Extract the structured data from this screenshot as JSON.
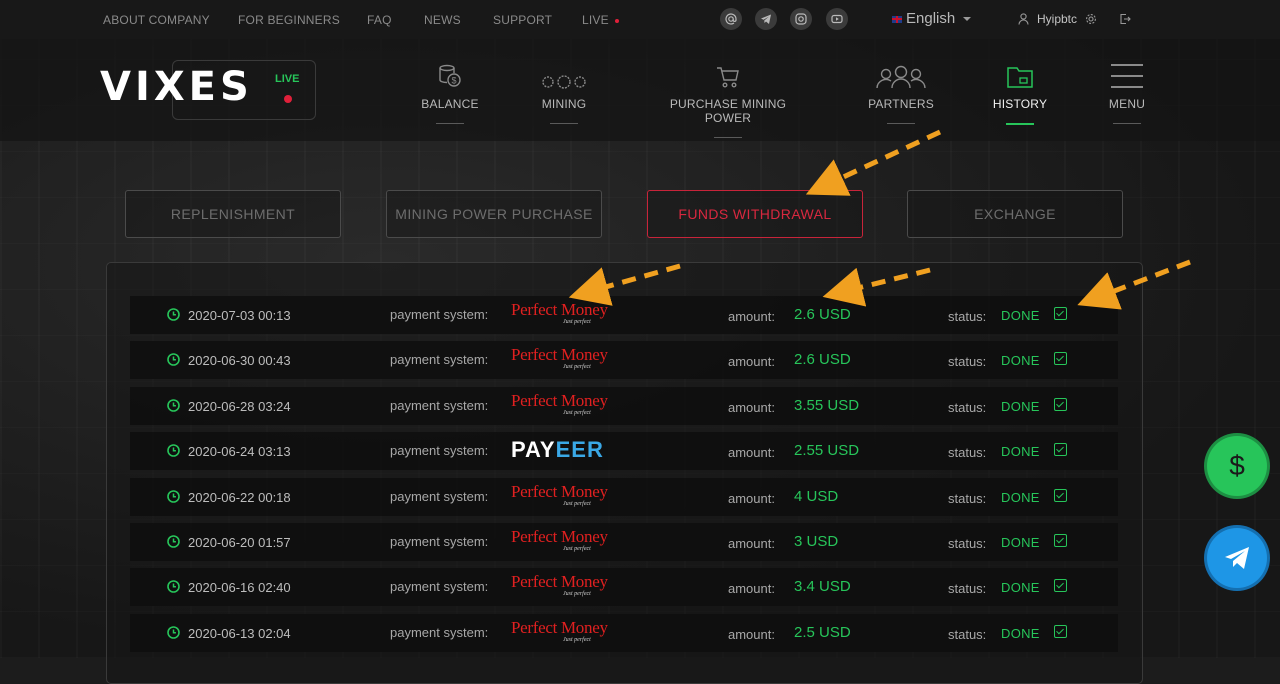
{
  "topbar": {
    "links": [
      "ABOUT COMPANY",
      "FOR BEGINNERS",
      "FAQ",
      "NEWS",
      "SUPPORT",
      "LIVE"
    ],
    "social_icons": [
      "at-icon",
      "telegram-icon",
      "instagram-icon",
      "youtube-icon"
    ],
    "language": "English",
    "username": "Hyipbtc"
  },
  "header": {
    "logo": "VIXES",
    "live_label": "LIVE",
    "nav": [
      {
        "label": "BALANCE",
        "icon": "coins-icon"
      },
      {
        "label": "MINING",
        "icon": "mining-icon"
      },
      {
        "label": "PURCHASE MINING POWER",
        "icon": "cart-icon"
      },
      {
        "label": "PARTNERS",
        "icon": "partners-icon"
      },
      {
        "label": "HISTORY",
        "icon": "history-folder-icon",
        "active": true
      },
      {
        "label": "MENU",
        "icon": "hamburger-icon"
      }
    ]
  },
  "tabs": [
    {
      "label": "REPLENISHMENT"
    },
    {
      "label": "MINING POWER PURCHASE"
    },
    {
      "label": "FUNDS WITHDRAWAL",
      "active": true
    },
    {
      "label": "EXCHANGE"
    }
  ],
  "history": {
    "payment_label": "payment system:",
    "amount_label": "amount:",
    "status_label": "status:",
    "pm_sub": "Just perfect",
    "rows": [
      {
        "date": "2020-07-03 00:13",
        "system": "Perfect Money",
        "amount": "2.6 USD",
        "status": "DONE"
      },
      {
        "date": "2020-06-30 00:43",
        "system": "Perfect Money",
        "amount": "2.6 USD",
        "status": "DONE"
      },
      {
        "date": "2020-06-28 03:24",
        "system": "Perfect Money",
        "amount": "3.55 USD",
        "status": "DONE"
      },
      {
        "date": "2020-06-24 03:13",
        "system": "PAYEER",
        "amount": "2.55 USD",
        "status": "DONE"
      },
      {
        "date": "2020-06-22 00:18",
        "system": "Perfect Money",
        "amount": "4 USD",
        "status": "DONE"
      },
      {
        "date": "2020-06-20 01:57",
        "system": "Perfect Money",
        "amount": "3 USD",
        "status": "DONE"
      },
      {
        "date": "2020-06-16 02:40",
        "system": "Perfect Money",
        "amount": "3.4 USD",
        "status": "DONE"
      },
      {
        "date": "2020-06-13 02:04",
        "system": "Perfect Money",
        "amount": "2.5 USD",
        "status": "DONE"
      }
    ]
  },
  "fabs": {
    "dollar_symbol": "$",
    "icons": [
      "dollar-icon",
      "telegram-icon"
    ]
  },
  "colors": {
    "accent_green": "#27c55a",
    "accent_red": "#d8283f",
    "annotation_arrow": "#f0a020"
  }
}
